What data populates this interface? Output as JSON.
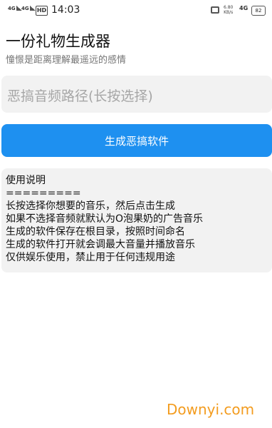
{
  "status_bar": {
    "sim1": "4G",
    "sim2": "4G",
    "hd": "HD",
    "time": "14:03",
    "speed_value": "6.80",
    "speed_unit": "KB/s",
    "network": "4G",
    "battery": "82"
  },
  "app": {
    "title": "一份礼物生成器",
    "subtitle": "憧憬是距离理解最遥远的感情"
  },
  "audio_path": {
    "placeholder": "恶搞音频路径(长按选择)"
  },
  "generate_button": {
    "label": "生成恶搞软件"
  },
  "instructions": {
    "lines": [
      "使用说明",
      "=========",
      "长按选择你想要的音乐，然后点击生成",
      "如果不选择音频就默认为O泡果奶的广告音乐",
      "生成的软件保存在根目录，按照时间命名",
      "生成的软件打开就会调最大音量并播放音乐",
      "仅供娱乐使用，禁止用于任何违规用途"
    ]
  },
  "watermark": {
    "text": "Downyi.com"
  },
  "colors": {
    "accent": "#1e90f0",
    "field_bg": "#f2f2f2",
    "watermark": "#f39c1f"
  }
}
